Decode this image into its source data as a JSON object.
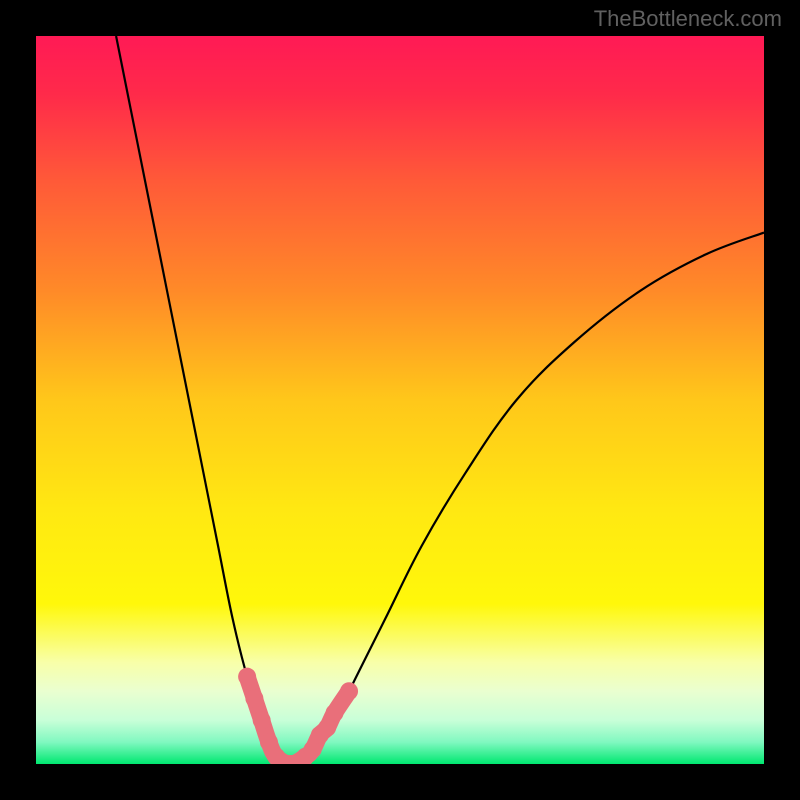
{
  "watermark": "TheBottleneck.com",
  "chart_data": {
    "type": "line",
    "title": "",
    "xlabel": "",
    "ylabel": "",
    "xlim": [
      0,
      100
    ],
    "ylim": [
      0,
      100
    ],
    "background": {
      "type": "vertical-gradient",
      "stops": [
        {
          "pos": 0.0,
          "color": "#ff1a55"
        },
        {
          "pos": 0.08,
          "color": "#ff2a4a"
        },
        {
          "pos": 0.2,
          "color": "#ff5a38"
        },
        {
          "pos": 0.35,
          "color": "#ff8a28"
        },
        {
          "pos": 0.5,
          "color": "#ffc71a"
        },
        {
          "pos": 0.65,
          "color": "#ffe812"
        },
        {
          "pos": 0.78,
          "color": "#fff80a"
        },
        {
          "pos": 0.86,
          "color": "#f8ffa8"
        },
        {
          "pos": 0.9,
          "color": "#eaffd0"
        },
        {
          "pos": 0.94,
          "color": "#c8ffd8"
        },
        {
          "pos": 0.97,
          "color": "#80f8c0"
        },
        {
          "pos": 1.0,
          "color": "#00e870"
        }
      ]
    },
    "series": [
      {
        "name": "left-branch",
        "stroke": "#000000",
        "points": [
          {
            "x": 11,
            "y": 100
          },
          {
            "x": 13,
            "y": 90
          },
          {
            "x": 15,
            "y": 80
          },
          {
            "x": 17,
            "y": 70
          },
          {
            "x": 19,
            "y": 60
          },
          {
            "x": 21,
            "y": 50
          },
          {
            "x": 23,
            "y": 40
          },
          {
            "x": 25,
            "y": 30
          },
          {
            "x": 27,
            "y": 20
          },
          {
            "x": 29,
            "y": 12
          },
          {
            "x": 31,
            "y": 6
          },
          {
            "x": 33,
            "y": 2
          },
          {
            "x": 35,
            "y": 0
          }
        ]
      },
      {
        "name": "right-branch",
        "stroke": "#000000",
        "points": [
          {
            "x": 35,
            "y": 0
          },
          {
            "x": 38,
            "y": 2
          },
          {
            "x": 41,
            "y": 6
          },
          {
            "x": 44,
            "y": 12
          },
          {
            "x": 48,
            "y": 20
          },
          {
            "x": 53,
            "y": 30
          },
          {
            "x": 59,
            "y": 40
          },
          {
            "x": 66,
            "y": 50
          },
          {
            "x": 74,
            "y": 58
          },
          {
            "x": 83,
            "y": 65
          },
          {
            "x": 92,
            "y": 70
          },
          {
            "x": 100,
            "y": 73
          }
        ]
      },
      {
        "name": "trough-markers",
        "stroke": "#e96f7a",
        "marker": true,
        "points": [
          {
            "x": 29,
            "y": 12
          },
          {
            "x": 30,
            "y": 9
          },
          {
            "x": 31,
            "y": 6
          },
          {
            "x": 32,
            "y": 3
          },
          {
            "x": 33,
            "y": 1
          },
          {
            "x": 35,
            "y": 0
          },
          {
            "x": 37,
            "y": 1
          },
          {
            "x": 38,
            "y": 2
          },
          {
            "x": 39,
            "y": 4
          },
          {
            "x": 40,
            "y": 5
          },
          {
            "x": 41,
            "y": 7
          },
          {
            "x": 43,
            "y": 10
          }
        ]
      }
    ]
  }
}
